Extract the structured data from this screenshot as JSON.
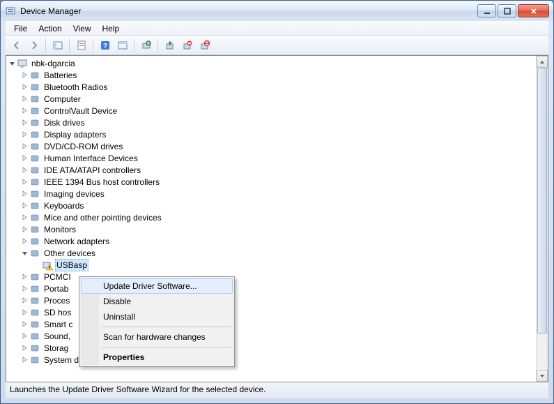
{
  "window": {
    "title": "Device Manager"
  },
  "menu": {
    "file": "File",
    "action": "Action",
    "view": "View",
    "help": "Help"
  },
  "tree": {
    "root": "nbk-dgarcia",
    "nodes": [
      "Batteries",
      "Bluetooth Radios",
      "Computer",
      "ControlVault Device",
      "Disk drives",
      "Display adapters",
      "DVD/CD-ROM drives",
      "Human Interface Devices",
      "IDE ATA/ATAPI controllers",
      "IEEE 1394 Bus host controllers",
      "Imaging devices",
      "Keyboards",
      "Mice and other pointing devices",
      "Monitors",
      "Network adapters"
    ],
    "other_label": "Other devices",
    "usb_item": "USBasp",
    "after": [
      "PCMCIA adapters",
      "Portable Devices",
      "Processors",
      "SD host adapters",
      "Smart card readers",
      "Sound, video and game controllers",
      "Storage controllers",
      "System devices"
    ],
    "after_trunc": [
      "PCMCI",
      "Portab",
      "Proces",
      "SD hos",
      "Smart c",
      "Sound,",
      "Storag",
      "System devices"
    ]
  },
  "context": {
    "update": "Update Driver Software...",
    "disable": "Disable",
    "uninstall": "Uninstall",
    "scan": "Scan for hardware changes",
    "properties": "Properties"
  },
  "status": "Launches the Update Driver Software Wizard for the selected device."
}
